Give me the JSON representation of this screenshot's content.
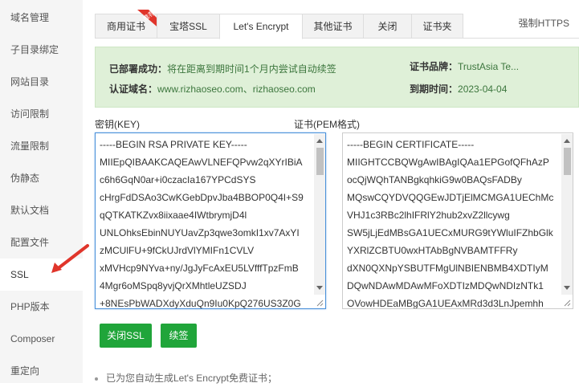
{
  "sidebar": {
    "items": [
      {
        "label": "域名管理"
      },
      {
        "label": "子目录绑定"
      },
      {
        "label": "网站目录"
      },
      {
        "label": "访问限制"
      },
      {
        "label": "流量限制"
      },
      {
        "label": "伪静态"
      },
      {
        "label": "默认文档"
      },
      {
        "label": "配置文件"
      },
      {
        "label": "SSL"
      },
      {
        "label": "PHP版本"
      },
      {
        "label": "Composer"
      },
      {
        "label": "重定向"
      }
    ],
    "active": "SSL"
  },
  "tabs": [
    {
      "label": "商用证书"
    },
    {
      "label": "宝塔SSL"
    },
    {
      "label": "Let's Encrypt"
    },
    {
      "label": "其他证书"
    },
    {
      "label": "关闭"
    },
    {
      "label": "证书夹"
    }
  ],
  "badge": "推荐",
  "tab_extra": "强制HTTPS",
  "status": {
    "deploy_key": "已部署成功：",
    "deploy_value": "将在距离到期时间1个月内尝试自动续签",
    "brand_key": "证书品牌：",
    "brand_value": "TrustAsia Te...",
    "domain_key": "认证域名：",
    "domain_value": "www.rizhaoseo.com、rizhaoseo.com",
    "expire_key": "到期时间：",
    "expire_value": "2023-04-04"
  },
  "key_label": "密钥(KEY)",
  "cert_label": "证书(PEM格式)",
  "key_lines": [
    "-----BEGIN RSA PRIVATE KEY-----",
    "MIIEpQIBAAKCAQEAwVLNEFQPvw2qXYrIBiA",
    "c6h6GqN0ar+i0czacIa167YPCdSYS",
    "cHrgFdDSAo3CwKGebDpvJba4BBOP0Q4I+S9",
    "qQTKATKZvx8iixaae4IWtbrymjD4l",
    "UNLOhksEbinNUYUavZp3qwe3omkI1xv7AxYI",
    "zMCUlFU+9fCkUJrdVlYMIFn1CVLV",
    "xMVHcp9NYva+ny/JgJyFcAxEU5LVfffTpzFmB",
    "4Mgr6oMSpq8yvjQrXMhtleUZSDJ",
    "+8NEsPbWADXdyXduQn9Iu0KpQ276US3Z0G"
  ],
  "cert_lines": [
    "-----BEGIN CERTIFICATE-----",
    "MIIGHTCCBQWgAwIBAgIQAa1EPGofQFhAzP",
    "ocQjWQhTANBgkqhkiG9w0BAQsFADBy",
    "MQswCQYDVQQGEwJDTjElMCMGA1UEChMc",
    "VHJ1c3RBc2lhIFRlY2hub2xvZ2llcywg",
    "SW5jLjEdMBsGA1UECxMURG9tYWluIFZhbGlk",
    "YXRlZCBTU0wxHTAbBgNVBAMTFFRy",
    "dXN0QXNpYSBUTFMgUlNBIENBMB4XDTIyM",
    "DQwNDAwMDAwMFoXDTIzMDQwNDIzNTk1",
    "OVowHDEaMBgGA1UEAxMRd3d3LnJpemhh"
  ],
  "buttons": {
    "close_ssl": "关闭SSL",
    "renew": "续签"
  },
  "note": "已为您自动生成Let's Encrypt免费证书；",
  "colors": {
    "primary_green": "#20a53a",
    "status_bg": "#dff0d8",
    "status_text": "#3c763d",
    "arrow_red": "#e0352b",
    "badge_red": "#e0352b"
  }
}
